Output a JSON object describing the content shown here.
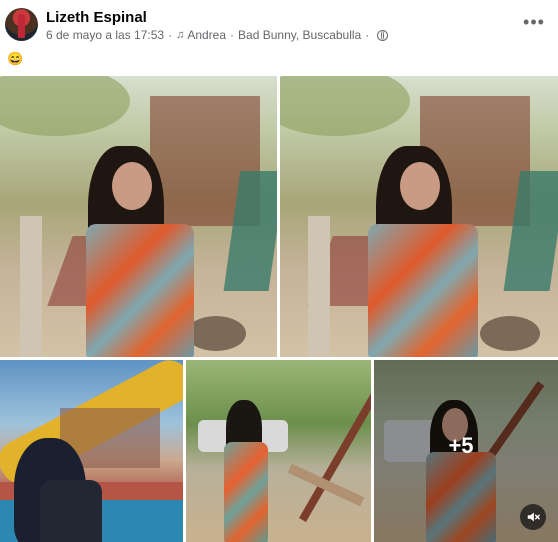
{
  "post": {
    "author": "Lizeth Espinal",
    "date": "6 de mayo a las 17:53",
    "song": "Andrea",
    "song_artist": "Bad Bunny, Buscabulla",
    "song_separator": "·",
    "text": "😄"
  },
  "gallery": {
    "more_count": "+5"
  },
  "icons": {
    "more": "more-options-icon",
    "music": "music-note-icon",
    "audience": "globe-icon",
    "mute": "speaker-muted-icon"
  }
}
